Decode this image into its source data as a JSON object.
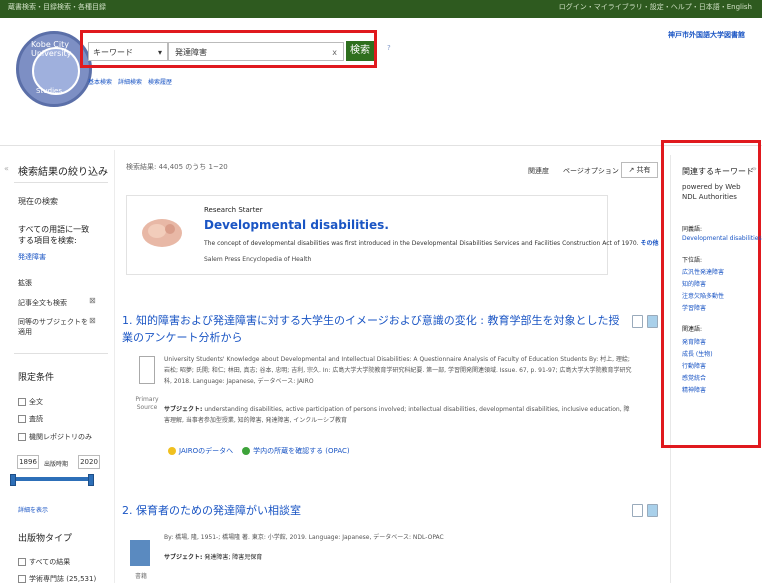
{
  "topbar": {
    "left": "蔵書検索・目録検索・各種目録",
    "right": "ログイン・マイライブラリ・設定・ヘルプ・日本語・English"
  },
  "logo": {
    "text_top": "Kobe City University",
    "text_bottom": "Studies"
  },
  "search": {
    "scope": "キーワード",
    "query": "発達障害",
    "clear": "x",
    "button": "検索",
    "help": "?"
  },
  "sublinks": "基本検索　詳細検索　検索履歴",
  "university": "神戸市外国語大学図書館",
  "sidebar": {
    "title": "検索結果の絞り込み",
    "current_search": "現在の検索",
    "match_all": "すべての用語に一致する項目を検索:",
    "term": "発達障害",
    "expand": "拡張",
    "fulltext": "記事全文も検索",
    "equivalent": "同等のサブジェクトを適用",
    "limit": "限定条件",
    "opt1": "全文",
    "opt2": "査読",
    "opt3": "機関レポジトリのみ",
    "year_from": "1896",
    "year_label": "出版時期",
    "year_to": "2020",
    "show_more": "詳細を表示",
    "pubtype": "出版物タイプ",
    "all_results": "すべての結果",
    "academic": "学術専門誌 (25,531)"
  },
  "results_header": {
    "count": "検索結果: 44,405 のうち 1~20",
    "relevance": "関連度",
    "page_options": "ページオプション",
    "share": "共有"
  },
  "research_starter": {
    "label": "Research Starter",
    "title": "Developmental disabilities.",
    "desc": "The concept of developmental disabilities was first introduced in the Developmental Disabilities Services and Facilities Construction Act of 1970.",
    "more": "その他",
    "source": "Salem Press Encyclopedia of Health"
  },
  "result1": {
    "num": "1.",
    "title": "知的障害および発達障害に対する大学生のイメージおよび意識の変化 : 教育学部生を対象とした授業のアンケート分析から",
    "body": "University Students' Knowledge about Developmental and Intellectual Disabilities: A Questionnaire Analysis of Faculty of Education Students By: 村上, 理絵; 岩松; 昭夢; 氏開; 和仁; 林田, 真志; 谷本, 忠明; 吉利, 宗久. In: 広島大学大学院教育学研究科紀要. 第一部, 学習開発関連領域. Issue. 67, p. 91-97; 広島大学大学院教育学研究科, 2018. Language: Japanese, データベース: JAIRO",
    "subjects_label": "サブジェクト:",
    "subjects": "understanding disabilities, active participation of persons involved; intellectual disabilities, developmental disabilities, inclusive education, 障害理解, 当事者参加型授業, 知的障害, 発達障害, インクルーシブ教育",
    "type": "Primary Source",
    "btn1": "JAIROのデータへ",
    "btn2": "学内の所蔵を確認する (OPAC)"
  },
  "result2": {
    "num": "2.",
    "title": "保育者のための発達障がい相談室",
    "by": "By: 橋場, 隆, 1951-; 橋場隆 著. 東京: 小学館, 2019. Language: Japanese, データベース: NDL-OPAC",
    "subjects_label": "サブジェクト:",
    "subjects": "発達障害; 障害児保育",
    "type": "書籍"
  },
  "keywords": {
    "title": "関連するキーワード",
    "powered": "powered by Web NDL Authorities",
    "synonym_label": "同義語:",
    "synonym": "Developmental disabilities",
    "narrower_label": "下位語:",
    "narrower": [
      "広汎性発達障害",
      "知的障害",
      "注意欠陥多動性",
      "学習障害"
    ],
    "related_label": "関連語:",
    "related": [
      "発育障害",
      "成長 (生物)",
      "行動障害",
      "感覚統合",
      "精神障害"
    ]
  }
}
